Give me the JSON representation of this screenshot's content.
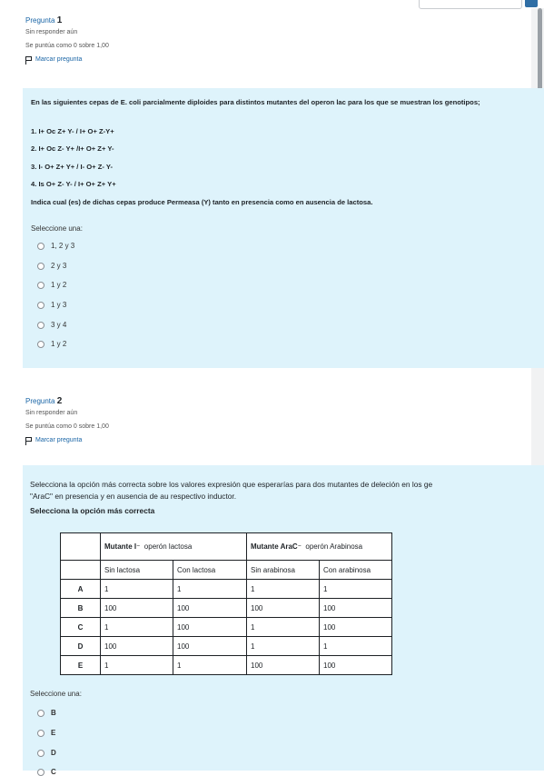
{
  "q1": {
    "label": "Pregunta",
    "number": "1",
    "status": "Sin responder aún",
    "score": "Se puntúa como 0 sobre 1,00",
    "flag_label": "Marcar pregunta",
    "text": "En las siguientes cepas de E. coli parcialmente diploides para distintos mutantes del operon lac para los que se muestran los genotipos;",
    "items": [
      "1. I+ Oc Z+ Y- / I+ O+ Z-Y+",
      "2. I+ Oc Z- Y+ /I+ O+ Z+ Y-",
      "3. I- O+ Z+ Y+ / I- O+ Z- Y-",
      "4. Is O+ Z- Y- / I+ O+ Z+ Y+"
    ],
    "indica": "Indica cual (es) de dichas cepas produce Permeasa (Y) tanto en presencia como en ausencia de lactosa.",
    "select_label": "Seleccione una:",
    "options": [
      "1, 2 y 3",
      "2 y 3",
      "1 y 2",
      "1 y 3",
      "3 y 4",
      "1 y 2"
    ]
  },
  "q2": {
    "label": "Pregunta",
    "number": "2",
    "status": "Sin responder aún",
    "score": "Se puntúa como 0 sobre 1,00",
    "flag_label": "Marcar pregunta",
    "text_line1": "Selecciona la opción más correcta sobre los valores expresión que esperarías para dos mutantes de deleción en los ge",
    "text_line2": "\"AraC\" en presencia y en ausencia de au respectivo inductor.",
    "bold_text": "Selecciona la opción más correcta",
    "table": {
      "header1_a": "Mutante I⁻",
      "header1_a_rest": "operón lactosa",
      "header1_b": "Mutante AraC⁻",
      "header1_b_rest": "operón Arabinosa",
      "subheaders": [
        "Sin lactosa",
        "Con lactosa",
        "Sin arabinosa",
        "Con arabinosa"
      ],
      "rows": [
        {
          "label": "A",
          "values": [
            "1",
            "1",
            "1",
            "1"
          ]
        },
        {
          "label": "B",
          "values": [
            "100",
            "100",
            "100",
            "100"
          ]
        },
        {
          "label": "C",
          "values": [
            "1",
            "100",
            "1",
            "100"
          ]
        },
        {
          "label": "D",
          "values": [
            "100",
            "100",
            "1",
            "1"
          ]
        },
        {
          "label": "E",
          "values": [
            "1",
            "1",
            "100",
            "100"
          ]
        }
      ]
    },
    "select_label": "Seleccione una:",
    "options": [
      "B",
      "E",
      "D",
      "C"
    ]
  }
}
